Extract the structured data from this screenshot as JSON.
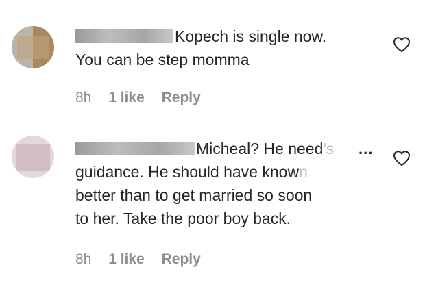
{
  "comments": [
    {
      "text_lines": [
        "Kopech is single now.",
        "You can be step momma"
      ],
      "time": "8h",
      "likes": "1 like",
      "reply_label": "Reply"
    },
    {
      "text_lines": [
        "Micheal? He need",
        "'s",
        "guidance. He should have know",
        "n",
        "better than to get married so soon",
        "to her. Take the poor boy back."
      ],
      "ellipsis": "...",
      "time": "8h",
      "likes": "1 like",
      "reply_label": "Reply"
    }
  ],
  "colors": {
    "text": "#262626",
    "meta": "#8e8e8e",
    "faded": "#bdbdbd",
    "background": "#ffffff"
  },
  "icons": {
    "like": "heart-icon"
  }
}
